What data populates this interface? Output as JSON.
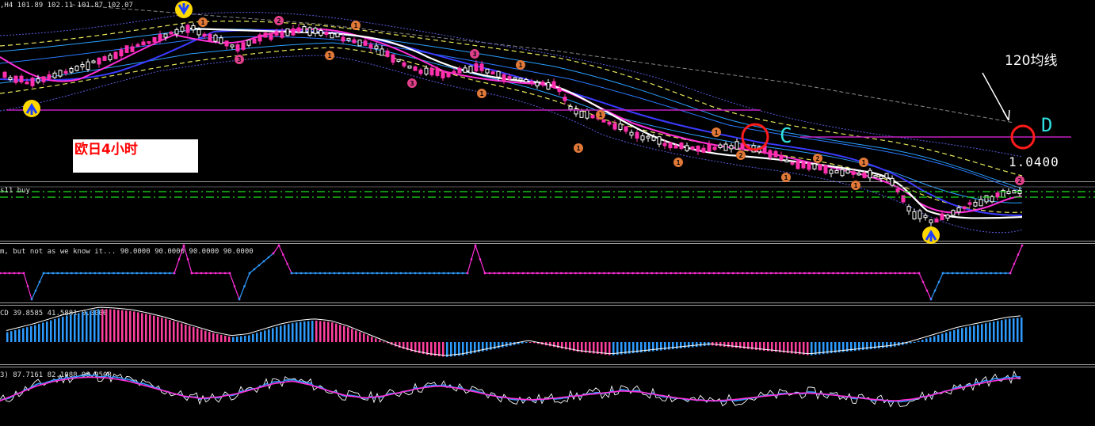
{
  "colors": {
    "bg": "#000000",
    "separator": "#9a9a9a",
    "up_candle": "#ffffff",
    "down_candle": "#ff2fae",
    "blue_line": "#3a3aff",
    "magenta_line": "#ff2fd8",
    "white_line": "#ffffff",
    "yellow_dash": "#e8e85a",
    "cyan_band": "#2aa0ff",
    "purple_band": "#5a5ae0",
    "hline": "#c020c0",
    "green_dash": "#1fe01f",
    "red_circle": "#ff1a1a",
    "label_cyan": "#30e0e0",
    "hist_blue": "#2e9bff",
    "hist_pink": "#ff3f9f",
    "grey_text": "#dcdcdc",
    "badge_orange": "#e07838",
    "badge_pink": "#e0408a",
    "arrow_yellow": "#ffd800",
    "arrow_blue": "#1f3fff"
  },
  "main": {
    "header": ",H4  101.89 102.11 101.87 102.07",
    "label_box": "欧日4小时",
    "note_ma": "120均线",
    "label_c": "C",
    "label_d": "D",
    "price_level": "1.0400",
    "buy_label": "s11 buy"
  },
  "sub1": {
    "header": "m, but not as we know it...  90.0000 90.0000 90.0000 90.0000"
  },
  "sub2": {
    "header": "CD 39.8585 41.5881 0.0000"
  },
  "sub3": {
    "header": "3) 87.7161 82.1088 98.9508"
  },
  "chart_data": {
    "type": "candlestick",
    "title": "欧日4小时",
    "symbol_header": ",H4  101.89 102.11 101.87 102.07",
    "price_annotation": "1.0400",
    "annotations": [
      "120均线",
      "C",
      "D"
    ],
    "main_close": [
      105,
      104,
      106,
      108,
      109,
      110,
      112,
      113,
      115,
      117,
      116,
      118,
      119,
      120,
      121,
      120,
      121,
      119,
      118,
      119,
      120,
      121,
      122,
      121,
      122,
      123,
      122,
      121,
      120,
      119,
      118,
      117,
      116,
      115,
      114,
      115,
      114,
      113,
      112,
      111,
      110,
      111,
      110,
      109,
      108,
      107,
      106,
      105,
      104,
      103,
      102,
      101,
      100,
      99,
      98,
      97,
      96,
      95,
      94,
      93,
      92,
      91,
      90,
      89,
      88,
      87,
      86,
      85,
      84,
      83,
      82,
      81,
      80,
      79,
      80,
      81,
      82,
      83,
      84,
      85,
      86
    ],
    "osc_steps": [
      -80,
      -90,
      -40,
      -40,
      -40,
      90,
      -40,
      -40,
      -80,
      -40,
      90,
      -40,
      -40,
      -40,
      -40,
      90,
      -40,
      -40,
      -40,
      -40,
      -40,
      -40,
      -40,
      -40,
      -40,
      -40,
      -40,
      -40,
      -40,
      -40,
      -90,
      -40,
      -40,
      -40,
      90
    ],
    "macd_hist": [
      10,
      15,
      20,
      26,
      32,
      36,
      40,
      39,
      37,
      33,
      28,
      22,
      16,
      10,
      6,
      8,
      14,
      20,
      24,
      26,
      24,
      18,
      10,
      2,
      -6,
      -12,
      -16,
      -18,
      -16,
      -12,
      -8,
      -4,
      0,
      -4,
      -8,
      -12,
      -14,
      -16,
      -14,
      -12,
      -10,
      -8,
      -6,
      -4,
      -6,
      -8,
      -10,
      -12,
      -14,
      -16,
      -14,
      -12,
      -10,
      -8,
      -6,
      -2,
      4,
      10,
      16,
      20,
      24,
      28,
      30
    ],
    "stoch_main": [
      40,
      55,
      70,
      80,
      86,
      88,
      86,
      80,
      70,
      60,
      50,
      45,
      48,
      55,
      65,
      75,
      80,
      72,
      60,
      50,
      46,
      50,
      58,
      66,
      70,
      66,
      58,
      50,
      45,
      42,
      44,
      48,
      52,
      56,
      60,
      58,
      52,
      46,
      42,
      40,
      42,
      46,
      50,
      54,
      56,
      54,
      50,
      46,
      42,
      40,
      44,
      52,
      62,
      70,
      78,
      84,
      87
    ]
  }
}
